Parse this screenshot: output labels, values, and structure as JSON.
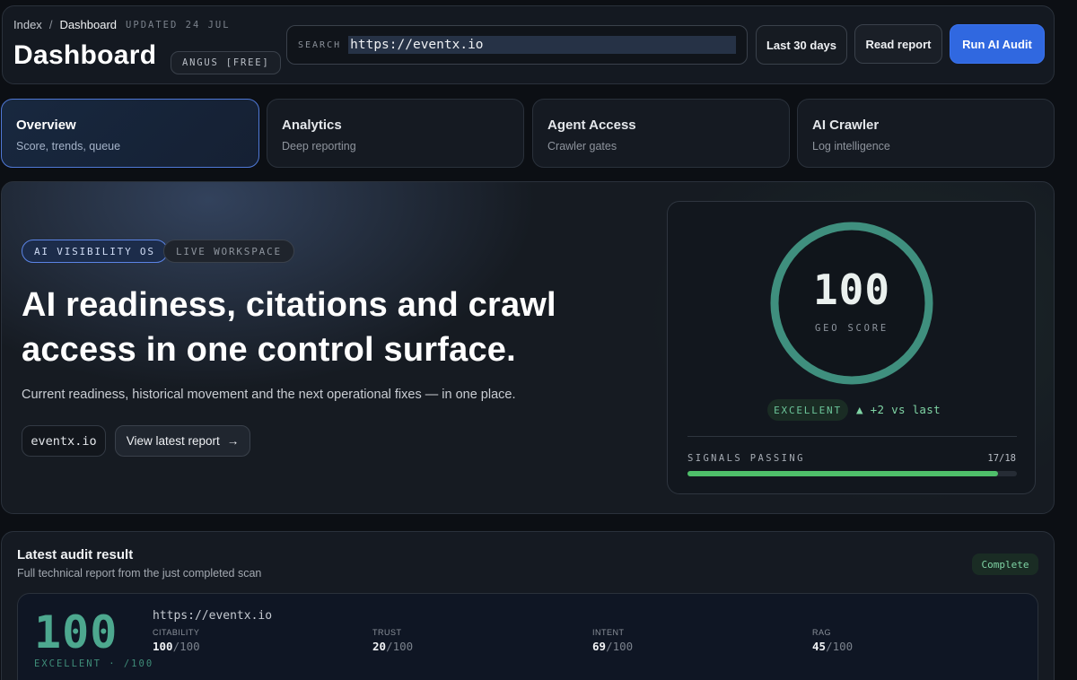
{
  "breadcrumb": {
    "index": "Index",
    "separator": "/",
    "current": "Dashboard",
    "updated": "UPDATED 24 JUL"
  },
  "header": {
    "title": "Dashboard",
    "plan_badge": "ANGUS [FREE]",
    "search_label": "SEARCH",
    "search_value": "https://eventx.io",
    "range_button": "Last 30 days",
    "read_report_button": "Read report",
    "run_audit_button": "Run AI Audit"
  },
  "tabs": [
    {
      "label": "Overview",
      "sub": "Score, trends, queue"
    },
    {
      "label": "Analytics",
      "sub": "Deep reporting"
    },
    {
      "label": "Agent Access",
      "sub": "Crawler gates"
    },
    {
      "label": "AI Crawler",
      "sub": "Log intelligence"
    }
  ],
  "hero": {
    "pill_primary": "AI VISIBILITY OS",
    "pill_secondary": "LIVE WORKSPACE",
    "headline_line1": "AI readiness, citations and crawl",
    "headline_line2": "access in one control surface.",
    "subtitle": "Current readiness, historical movement and the next operational fixes — in one place.",
    "domain_chip": "eventx.io",
    "latest_report_button": "View latest report",
    "arrow": "→"
  },
  "score": {
    "value": "100",
    "label": "GEO SCORE",
    "ring_fraction": 1.0,
    "rating": "EXCELLENT",
    "delta": "▲ +2 vs last",
    "signals_label": "SIGNALS PASSING",
    "signals_value": "17/18",
    "signals_fraction": 0.944
  },
  "audit": {
    "title": "Latest audit result",
    "subtitle": "Full technical report from the just completed scan",
    "status": "Complete",
    "score": "100",
    "score_label": "EXCELLENT · /100",
    "url": "https://eventx.io",
    "metrics": [
      {
        "label": "CITABILITY",
        "value": "100",
        "max": "/100"
      },
      {
        "label": "TRUST",
        "value": "20",
        "max": "/100"
      },
      {
        "label": "INTENT",
        "value": "69",
        "max": "/100"
      },
      {
        "label": "RAG",
        "value": "45",
        "max": "/100"
      }
    ]
  },
  "colors": {
    "accent": "#3068e0",
    "ring": "#3f8f7e",
    "success": "#4fbf6a",
    "score_green": "#4da88f"
  }
}
